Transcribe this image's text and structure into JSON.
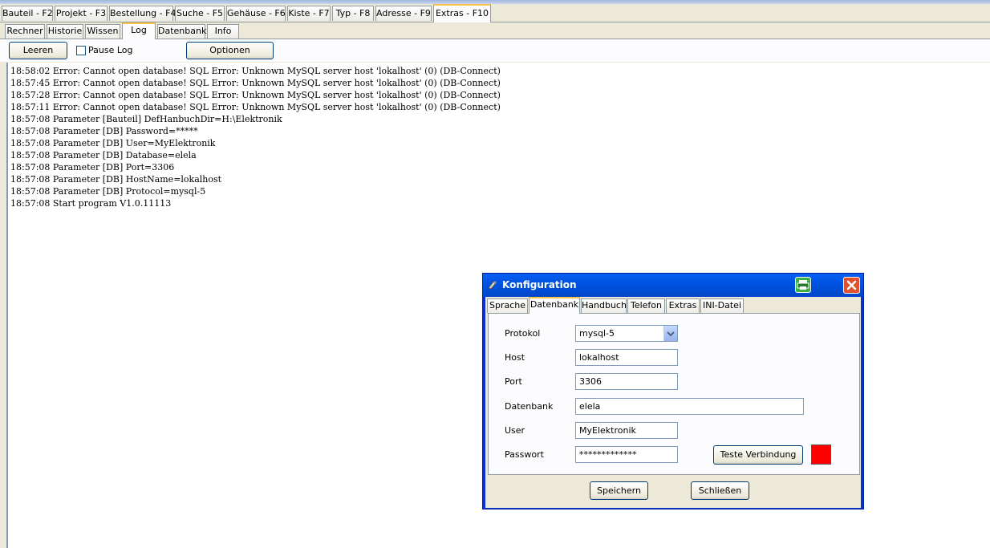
{
  "main_tabs": [
    {
      "label": "Bauteil - F2",
      "active": false
    },
    {
      "label": "Projekt - F3",
      "active": false
    },
    {
      "label": "Bestellung - F4",
      "active": false
    },
    {
      "label": "Suche - F5",
      "active": false
    },
    {
      "label": "Gehäuse - F6",
      "active": false
    },
    {
      "label": "Kiste - F7",
      "active": false
    },
    {
      "label": "Typ - F8",
      "active": false
    },
    {
      "label": "Adresse - F9",
      "active": false
    },
    {
      "label": "Extras - F10",
      "active": true
    }
  ],
  "sub_tabs": [
    {
      "label": "Rechner",
      "active": false
    },
    {
      "label": "Historie",
      "active": false
    },
    {
      "label": "Wissen",
      "active": false
    },
    {
      "label": "Log",
      "active": true
    },
    {
      "label": "Datenbank",
      "active": false
    },
    {
      "label": "Info",
      "active": false
    }
  ],
  "toolbar": {
    "clear_label": "Leeren",
    "pause_label": "Pause Log",
    "pause_checked": false,
    "options_label": "Optionen"
  },
  "log_lines": [
    "18:58:02 Error: Cannot open database! SQL Error: Unknown MySQL server host 'lokalhost' (0) (DB-Connect)",
    "18:57:45 Error: Cannot open database! SQL Error: Unknown MySQL server host 'lokalhost' (0) (DB-Connect)",
    "18:57:28 Error: Cannot open database! SQL Error: Unknown MySQL server host 'lokalhost' (0) (DB-Connect)",
    "18:57:11 Error: Cannot open database! SQL Error: Unknown MySQL server host 'lokalhost' (0) (DB-Connect)",
    "18:57:08 Parameter [Bauteil] DefHanbuchDir=H:\\Elektronik",
    "18:57:08 Parameter [DB] Password=*****",
    "18:57:08 Parameter [DB] User=MyElektronik",
    "18:57:08 Parameter [DB] Database=elela",
    "18:57:08 Parameter [DB] Port=3306",
    "18:57:08 Parameter [DB] HostName=lokalhost",
    "18:57:08 Parameter [DB] Protocol=mysql-5",
    "18:57:08 Start program V1.0.11113"
  ],
  "dialog": {
    "title": "Konfiguration",
    "tabs": [
      {
        "label": "Sprache",
        "active": false
      },
      {
        "label": "Datenbank",
        "active": true
      },
      {
        "label": "Handbuch",
        "active": false
      },
      {
        "label": "Telefon",
        "active": false
      },
      {
        "label": "Extras",
        "active": false
      },
      {
        "label": "INI-Datei",
        "active": false
      }
    ],
    "fields": {
      "protocol": {
        "label": "Protokol",
        "value": "mysql-5"
      },
      "host": {
        "label": "Host",
        "value": "lokalhost"
      },
      "port": {
        "label": "Port",
        "value": "3306"
      },
      "database": {
        "label": "Datenbank",
        "value": "elela"
      },
      "user": {
        "label": "User",
        "value": "MyElektronik"
      },
      "password": {
        "label": "Passwort",
        "value": "*************"
      }
    },
    "test_button": "Teste Verbindung",
    "status_color": "#ff0000",
    "save_button": "Speichern",
    "close_button": "Schließen"
  },
  "colors": {
    "accent_tab": "#f7c54a",
    "dialog_titlebar": "#0054e3",
    "close_button": "#e0502a",
    "print_icon": "#3cb043"
  }
}
